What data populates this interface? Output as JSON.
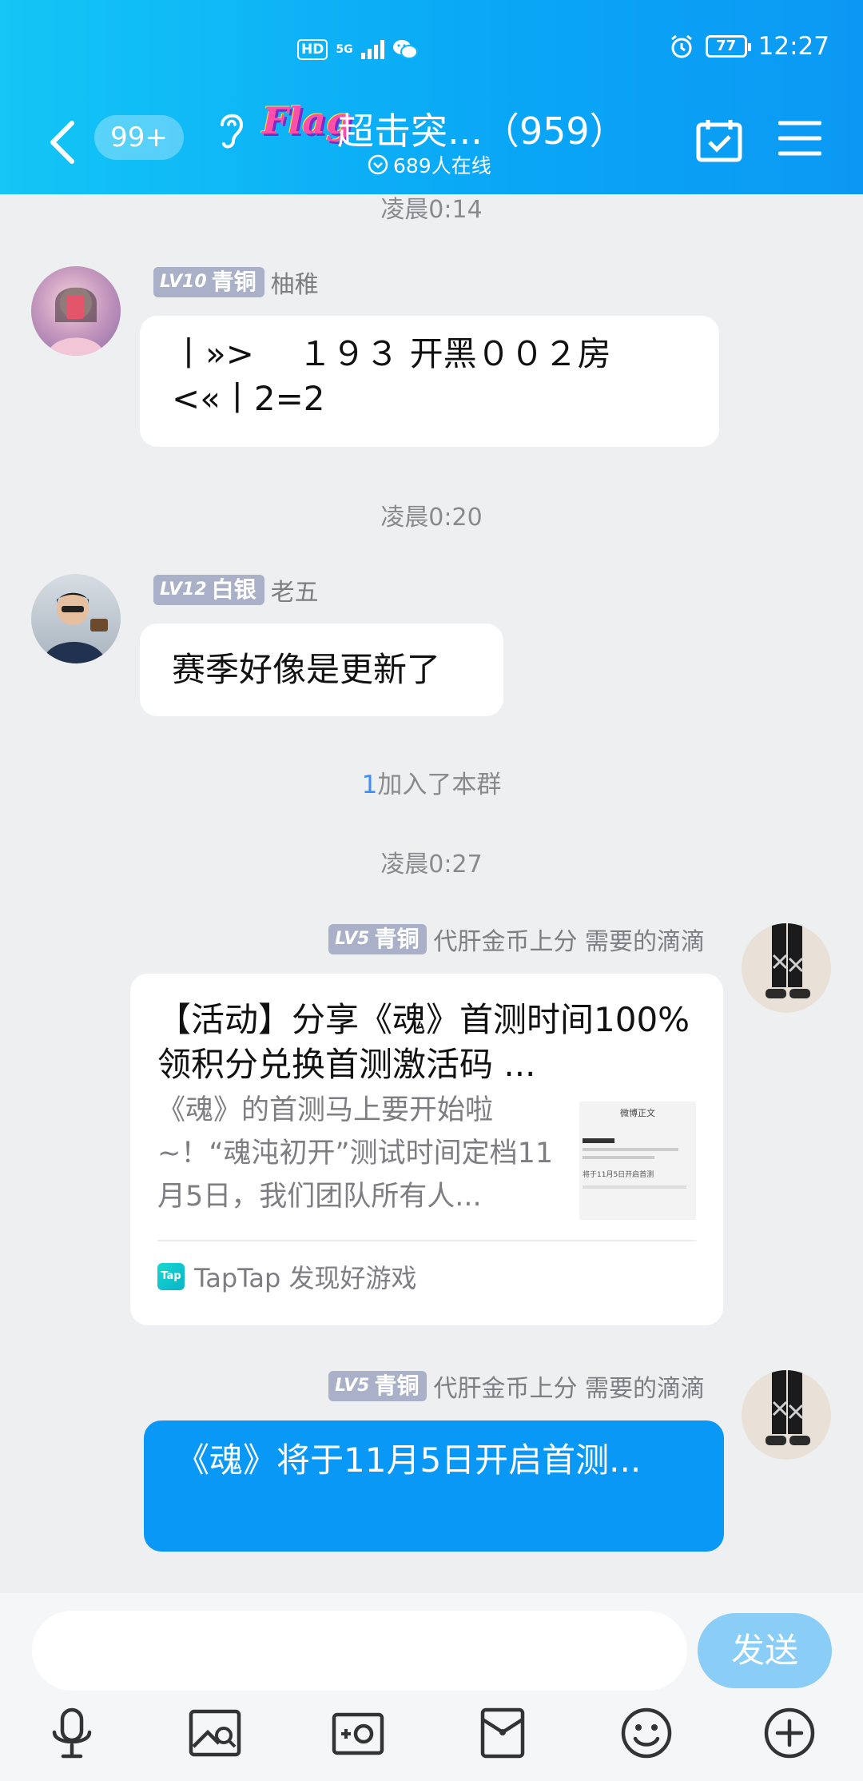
{
  "status_bar": {
    "hd": "HD",
    "network": "5G",
    "battery": "77",
    "time": "12:27"
  },
  "nav": {
    "back_badge": "99+",
    "group_flag": "Flag",
    "group_title": "超击突...（959）",
    "online": "689人在线"
  },
  "messages": {
    "time1": "凌晨0:14",
    "m1": {
      "level": "LV10",
      "rank": "青铜",
      "name": "柚稚",
      "text": "丨»>　 １９３ 开黑００２房<«丨2=2"
    },
    "time2": "凌晨0:20",
    "m2": {
      "level": "LV12",
      "rank": "白银",
      "name": "老五",
      "text": "赛季好像是更新了"
    },
    "join_number": "1",
    "join_text": "加入了本群",
    "time3": "凌晨0:27",
    "m3": {
      "level": "LV5",
      "rank": "青铜",
      "name": "代肝金币上分 需要的滴滴",
      "card_title": "【活动】分享《魂》首测时间100%领积分兑换首测激活码 ...",
      "card_desc": "《魂》的首测马上要开始啦~！“魂沌初开”测试时间定档11月5日，我们团队所有人...",
      "thumb_title": "微博正文",
      "thumb_line": "将于11月5日开启首测",
      "source_icon": "Tap",
      "source": "TapTap 发现好游戏"
    },
    "m4": {
      "level": "LV5",
      "rank": "青铜",
      "name": "代肝金币上分 需要的滴滴",
      "text": "《魂》将于11月5日开启首测..."
    }
  },
  "input": {
    "value": "",
    "send_label": "发送"
  },
  "icons": [
    "mic-icon",
    "image-icon",
    "camera-icon",
    "red-packet-icon",
    "emoji-icon",
    "plus-icon"
  ],
  "colors": {
    "header": "#0aa8f6",
    "accent": "#0a98f6",
    "send_disabled": "#8acdf6",
    "level_badge": "#a9b0c8"
  }
}
